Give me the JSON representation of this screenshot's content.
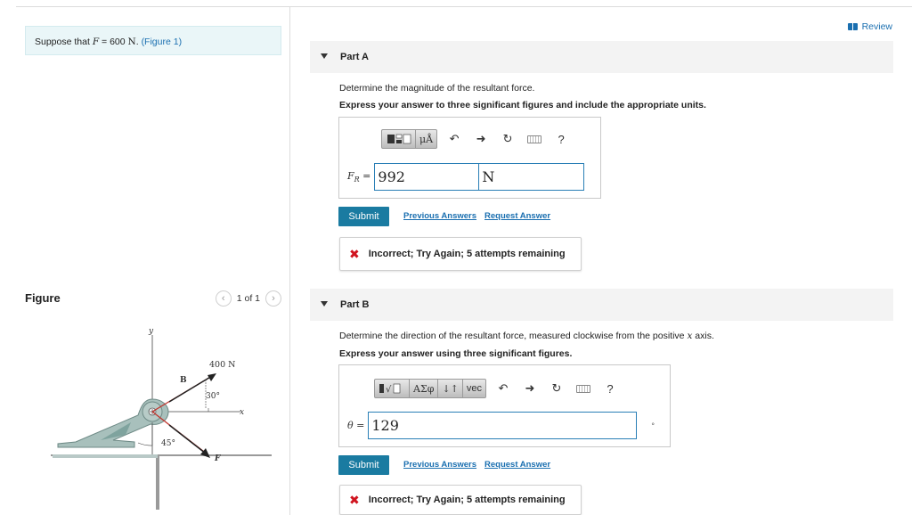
{
  "problem": {
    "intro": "Suppose that",
    "var": "F",
    "equals": "= 600",
    "unit": "N",
    "sep": ".",
    "figure_link": "(Figure 1)"
  },
  "figure_panel": {
    "title": "Figure",
    "prev_icon": "chevron-left-icon",
    "next_icon": "chevron-right-icon",
    "pager": "1 of 1",
    "labels": {
      "y": "y",
      "x": "x",
      "b": "B",
      "force400": "400 N",
      "angle30": "30°",
      "angle45": "45°",
      "f": "F"
    }
  },
  "review": {
    "label": "Review",
    "icon": "book-icon"
  },
  "partA": {
    "title": "Part A",
    "question": "Determine the magnitude of the resultant force.",
    "instruction": "Express your answer to three significant figures and include the appropriate units.",
    "toolbar": {
      "template_glyph": "▪▫",
      "mu": "μÅ",
      "help": "?"
    },
    "input_label": "F",
    "input_sub": "R",
    "input_eq": "=",
    "value": "992",
    "unit": "N",
    "submit": "Submit",
    "prev_answers": "Previous Answers",
    "request_answer": "Request Answer",
    "feedback": "Incorrect; Try Again; 5 attempts remaining"
  },
  "partB": {
    "title": "Part B",
    "question_pre": "Determine the direction of the resultant force, measured clockwise from the positive",
    "question_var": "x",
    "question_post": "axis.",
    "instruction": "Express your answer using three significant figures.",
    "toolbar": {
      "template_glyph": "▪√▫",
      "greek": "ΑΣφ",
      "arrows": "↓↑",
      "vec": "vec",
      "help": "?"
    },
    "input_label": "θ",
    "input_eq": "=",
    "value": "129",
    "unit": "°",
    "submit": "Submit",
    "prev_answers": "Previous Answers",
    "request_answer": "Request Answer",
    "feedback": "Incorrect; Try Again; 5 attempts remaining"
  },
  "colors": {
    "accent": "#1a7ba1",
    "link": "#1a6fb0",
    "error": "#d0141f",
    "problem_bg": "#eaf6f8"
  }
}
